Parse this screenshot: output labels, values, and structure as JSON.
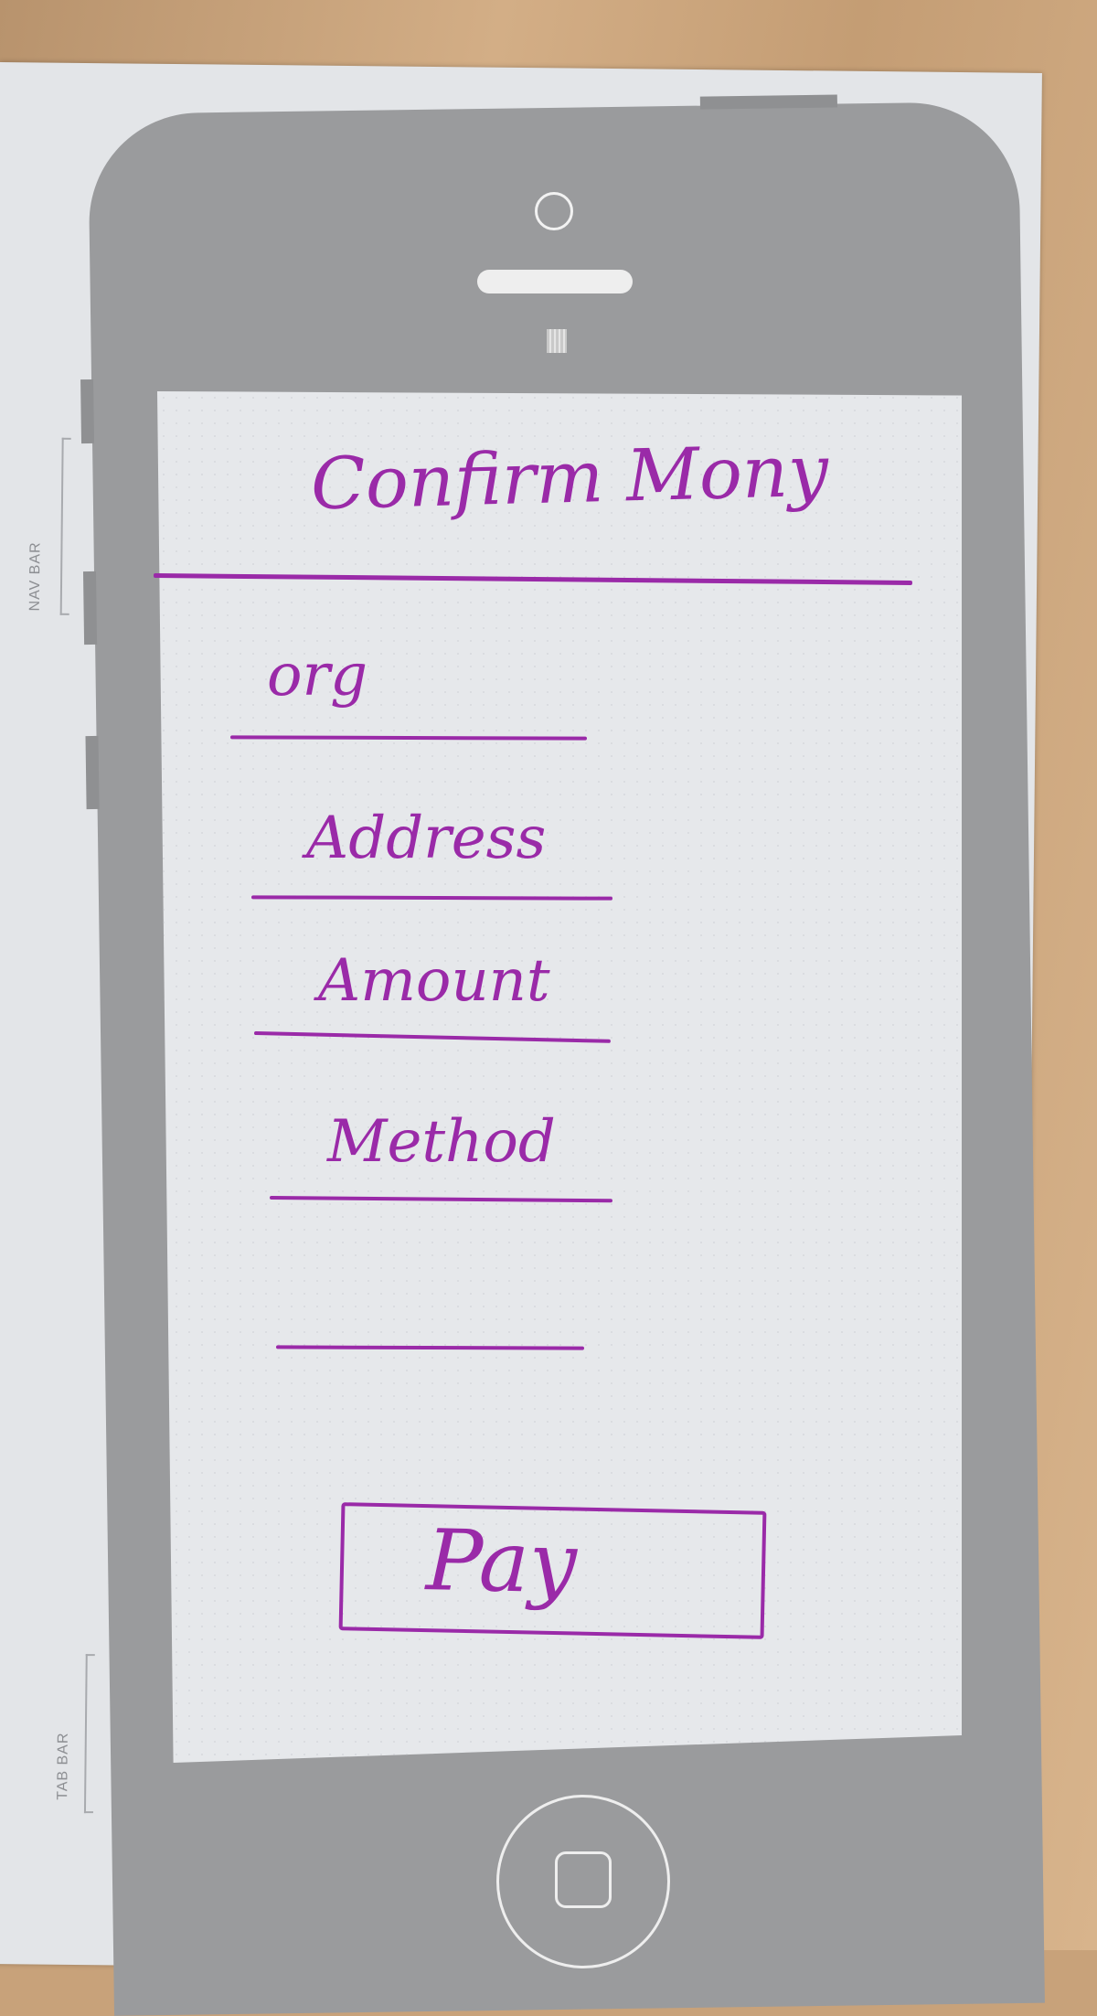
{
  "template_labels": {
    "nav_bar": "NAV BAR",
    "tab_bar": "TAB BAR"
  },
  "header": {
    "title": "Confirm Mony"
  },
  "form": {
    "fields": [
      {
        "label": "org"
      },
      {
        "label": "Address"
      },
      {
        "label": "Amount"
      },
      {
        "label": "Method"
      },
      {
        "label": ""
      }
    ]
  },
  "pay_button": {
    "label": "Pay"
  },
  "colors": {
    "ink": "#9a2aa8",
    "phone_body": "#9a9b9d",
    "screen": "#e6e8eb",
    "desk": "#c8a27a"
  }
}
